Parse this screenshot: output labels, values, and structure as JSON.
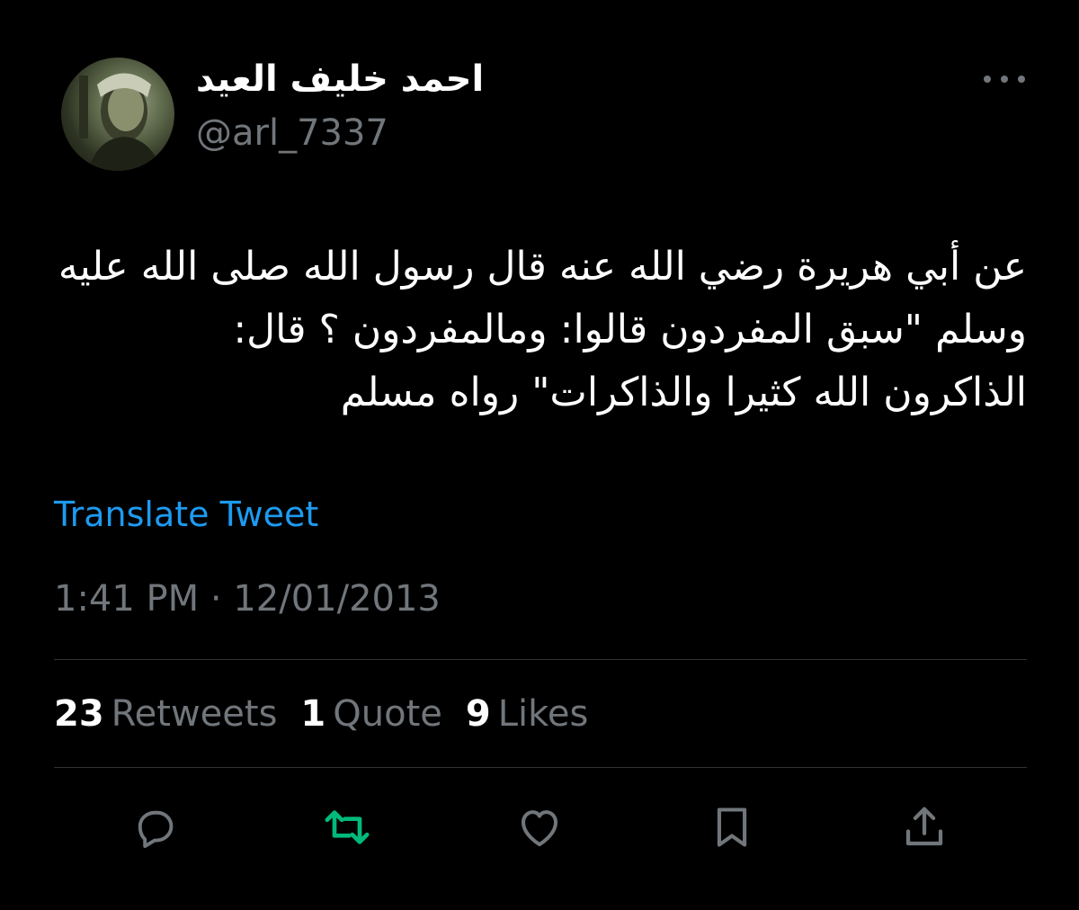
{
  "author": {
    "display_name": "احمد خليف العيد",
    "handle": "@arl_7337",
    "avatar_icon": "profile-photo"
  },
  "tweet": {
    "text_lines": [
      "عن أبي هريرة رضي الله عنه قال رسول الله صلى الله عليه",
      "وسلم \"سبق المفردون قالوا: ومالمفردون ؟ قال:",
      "الذاكرون الله كثيرا والذاكرات\" رواه مسلم"
    ],
    "translate_label": "Translate Tweet",
    "timestamp": "1:41 PM · 12/01/2013"
  },
  "stats": {
    "retweets": {
      "count": "23",
      "label": "Retweets"
    },
    "quotes": {
      "count": "1",
      "label": "Quote"
    },
    "likes": {
      "count": "9",
      "label": "Likes"
    }
  },
  "actions": [
    "reply-icon",
    "retweet-icon",
    "like-icon",
    "bookmark-icon",
    "share-icon"
  ],
  "colors": {
    "background": "#000000",
    "primary_text": "#ffffff",
    "secondary_text": "#71767b",
    "link": "#1d9bf0",
    "retweet_active": "#00ba7c",
    "divider": "#2f3336"
  }
}
